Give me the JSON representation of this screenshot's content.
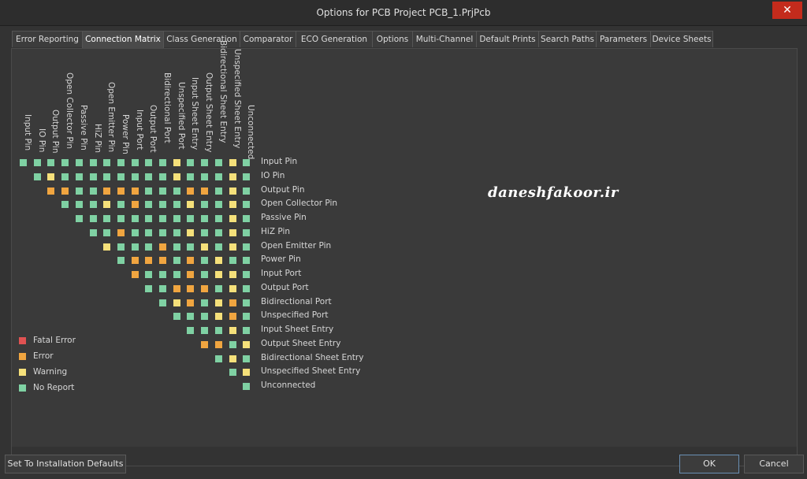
{
  "window": {
    "title": "Options for PCB Project PCB_1.PrjPcb",
    "close_glyph": "✕"
  },
  "tabs": [
    "Error Reporting",
    "Connection Matrix",
    "Class Generation",
    "Comparator",
    "ECO Generation",
    "Options",
    "Multi-Channel",
    "Default Prints",
    "Search Paths",
    "Parameters",
    "Device Sheets"
  ],
  "active_tab": "Connection Matrix",
  "matrix": {
    "types": [
      "Input Pin",
      "IO Pin",
      "Output Pin",
      "Open Collector Pin",
      "Passive Pin",
      "HiZ Pin",
      "Open Emitter Pin",
      "Power Pin",
      "Input Port",
      "Output Port",
      "Bidirectional Port",
      "Unspecified Port",
      "Input Sheet Entry",
      "Output Sheet Entry",
      "Bidirectional Sheet Entry",
      "Unspecified Sheet Entry",
      "Unconnected"
    ],
    "rows": [
      [
        "N",
        "N",
        "N",
        "N",
        "N",
        "N",
        "N",
        "N",
        "N",
        "N",
        "N",
        "W",
        "N",
        "N",
        "N",
        "W",
        "N"
      ],
      [
        "N",
        "W",
        "N",
        "N",
        "N",
        "N",
        "N",
        "N",
        "N",
        "N",
        "W",
        "N",
        "N",
        "N",
        "W",
        "N"
      ],
      [
        "E",
        "E",
        "N",
        "N",
        "E",
        "E",
        "E",
        "N",
        "N",
        "N",
        "E",
        "E",
        "N",
        "W",
        "N"
      ],
      [
        "N",
        "N",
        "N",
        "W",
        "N",
        "E",
        "N",
        "N",
        "N",
        "W",
        "N",
        "N",
        "W",
        "N"
      ],
      [
        "N",
        "N",
        "N",
        "N",
        "N",
        "N",
        "N",
        "N",
        "N",
        "N",
        "N",
        "W",
        "N"
      ],
      [
        "N",
        "N",
        "E",
        "N",
        "N",
        "N",
        "N",
        "W",
        "N",
        "N",
        "W",
        "N"
      ],
      [
        "W",
        "N",
        "N",
        "N",
        "E",
        "N",
        "N",
        "W",
        "N",
        "W",
        "N"
      ],
      [
        "N",
        "E",
        "E",
        "E",
        "N",
        "E",
        "N",
        "W",
        "N",
        "N"
      ],
      [
        "E",
        "N",
        "N",
        "N",
        "E",
        "N",
        "W",
        "W",
        "N"
      ],
      [
        "N",
        "N",
        "E",
        "E",
        "E",
        "N",
        "W",
        "N"
      ],
      [
        "N",
        "W",
        "E",
        "N",
        "W",
        "E",
        "N"
      ],
      [
        "N",
        "N",
        "N",
        "W",
        "E",
        "N"
      ],
      [
        "N",
        "N",
        "N",
        "W",
        "N"
      ],
      [
        "E",
        "E",
        "N",
        "W"
      ],
      [
        "N",
        "W",
        "N"
      ],
      [
        "N",
        "W"
      ],
      [
        "N"
      ]
    ]
  },
  "legend": [
    {
      "key": "F",
      "label": "Fatal Error",
      "color": "#e05252"
    },
    {
      "key": "E",
      "label": "Error",
      "color": "#f0a540"
    },
    {
      "key": "W",
      "label": "Warning",
      "color": "#f5e07a"
    },
    {
      "key": "N",
      "label": "No Report",
      "color": "#7fd1a3"
    }
  ],
  "watermark": "daneshfakoor.ir",
  "buttons": {
    "defaults": "Set To Installation Defaults",
    "ok": "OK",
    "cancel": "Cancel"
  }
}
